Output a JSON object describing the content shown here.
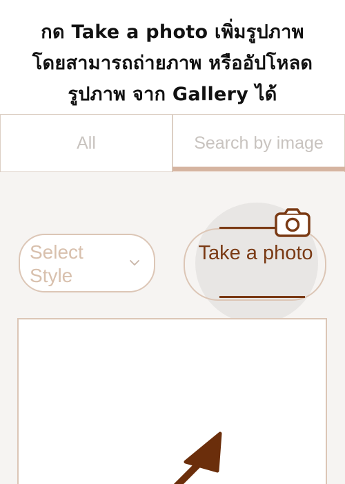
{
  "instruction": {
    "line1": "กด Take a photo เพิ่มรูปภาพ",
    "line2": "โดยสามารถถ่ายภาพ หรืออัปโหลด",
    "line3": "รูปภาพ จาก  Gallery ได้"
  },
  "tabs": [
    {
      "label": "All"
    },
    {
      "label": "Search by image",
      "active": true
    }
  ],
  "select_style": {
    "label": "Select Style"
  },
  "take_photo": {
    "label": "Take a photo"
  },
  "icons": {
    "camera": "camera-icon",
    "chevron": "chevron-down-icon",
    "arrow": "pointer-arrow"
  },
  "colors": {
    "accent": "#7a3a14",
    "border": "#dcc6b6",
    "tab_underline": "#d5b4a0"
  }
}
